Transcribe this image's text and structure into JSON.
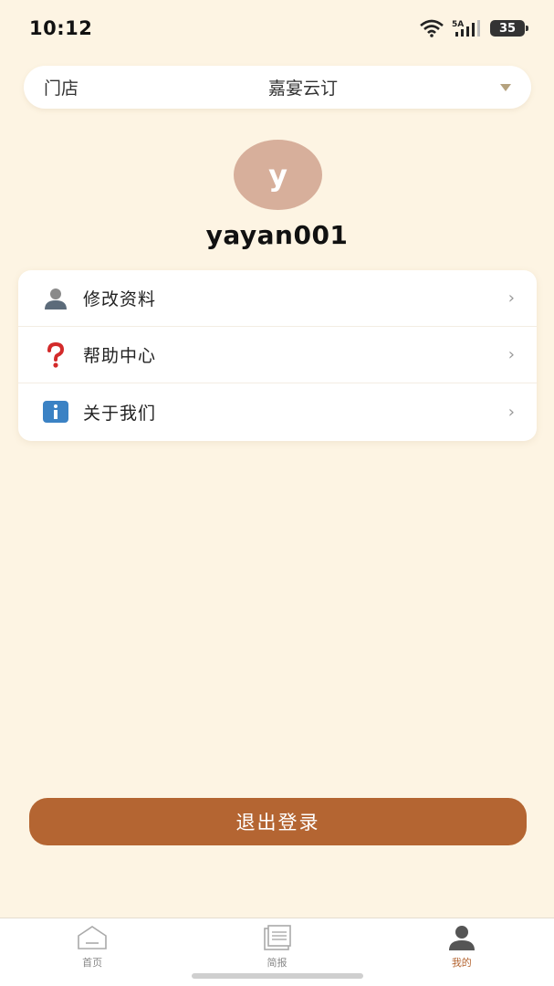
{
  "status_bar": {
    "time": "10:12",
    "network": "5A",
    "battery": "35"
  },
  "store": {
    "label": "门店",
    "value": "嘉宴云订"
  },
  "profile": {
    "avatar_letter": "y",
    "username": "yayan001"
  },
  "menu": {
    "items": [
      {
        "label": "修改资料",
        "icon": "user-icon"
      },
      {
        "label": "帮助中心",
        "icon": "question-icon"
      },
      {
        "label": "关于我们",
        "icon": "info-icon"
      }
    ]
  },
  "logout_label": "退出登录",
  "tabs": [
    {
      "label": "首页",
      "icon": "home-icon"
    },
    {
      "label": "简报",
      "icon": "report-icon"
    },
    {
      "label": "我的",
      "icon": "profile-icon",
      "active": true
    }
  ],
  "colors": {
    "background": "#fdf4e3",
    "accent": "#b46532",
    "avatar": "#d7af9b"
  }
}
